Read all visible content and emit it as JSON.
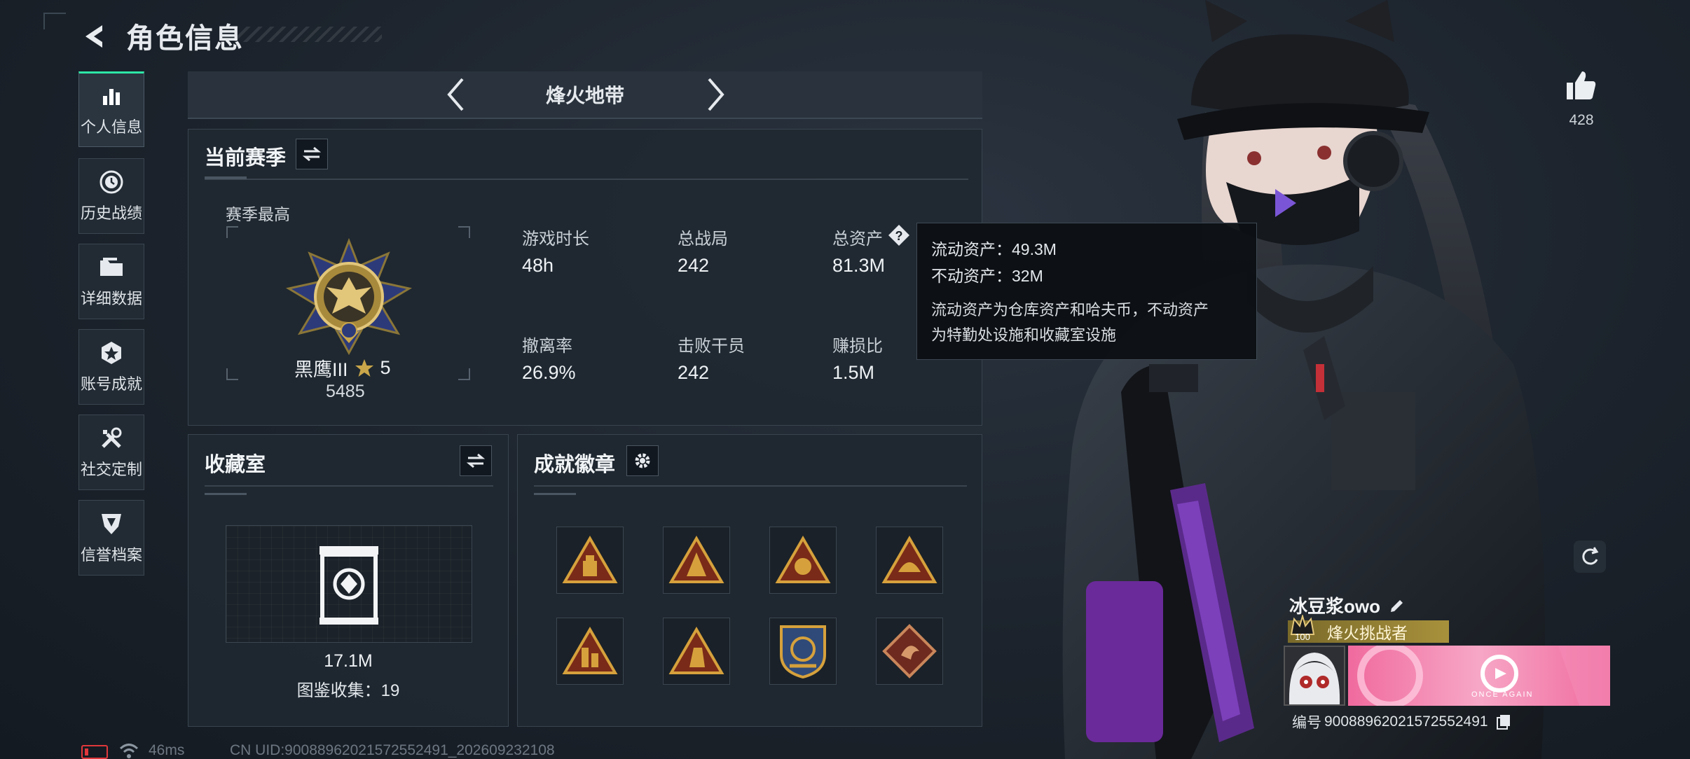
{
  "header": {
    "title": "角色信息"
  },
  "sidebar": {
    "items": [
      {
        "label": "个人信息",
        "icon": "bar-chart-icon",
        "active": true
      },
      {
        "label": "历史战绩",
        "icon": "history-clock-icon"
      },
      {
        "label": "详细数据",
        "icon": "folder-icon"
      },
      {
        "label": "账号成就",
        "icon": "achievement-icon"
      },
      {
        "label": "社交定制",
        "icon": "tools-icon"
      },
      {
        "label": "信誉档案",
        "icon": "shield-icon"
      }
    ]
  },
  "mode": {
    "name": "烽火地带"
  },
  "season": {
    "title": "当前赛季",
    "best_label": "赛季最高",
    "rank_name": "黑鹰III",
    "rank_stars": "5",
    "rank_score": "5485",
    "stats": [
      {
        "label": "游戏时长",
        "value": "48h"
      },
      {
        "label": "总战局",
        "value": "242"
      },
      {
        "label": "总资产",
        "value": "81.3M"
      },
      {
        "label": "撤离率",
        "value": "26.9%"
      },
      {
        "label": "击败干员",
        "value": "242"
      },
      {
        "label": "赚损比",
        "value": "1.5M"
      }
    ]
  },
  "tooltip": {
    "liquid": "流动资产：49.3M",
    "fixed": "不动资产：32M",
    "desc_line1": "流动资产为仓库资产和哈夫币，不动资产",
    "desc_line2": "为特勤处设施和收藏室设施"
  },
  "collection": {
    "title": "收藏室",
    "value": "17.1M",
    "catalog": "图鉴收集：19"
  },
  "achievements": {
    "title": "成就徽章",
    "badges": [
      "badge-1",
      "badge-2",
      "badge-3",
      "badge-4",
      "badge-5",
      "badge-6",
      "badge-7",
      "badge-8"
    ]
  },
  "profile": {
    "likes": "428",
    "name": "冰豆浆owo",
    "level": "100",
    "title_tag": "烽火挑战者",
    "id_label": "编号",
    "id_number": "9008896202157255249​1",
    "card_text": "ONCE AGAIN"
  },
  "statusbar": {
    "ping": "46ms",
    "uid": "CN UID:9008896202157255249​1_202609232108"
  },
  "colors": {
    "accent": "#2ee7a6",
    "gold": "#c9a64a",
    "battery": "#e0383c"
  }
}
